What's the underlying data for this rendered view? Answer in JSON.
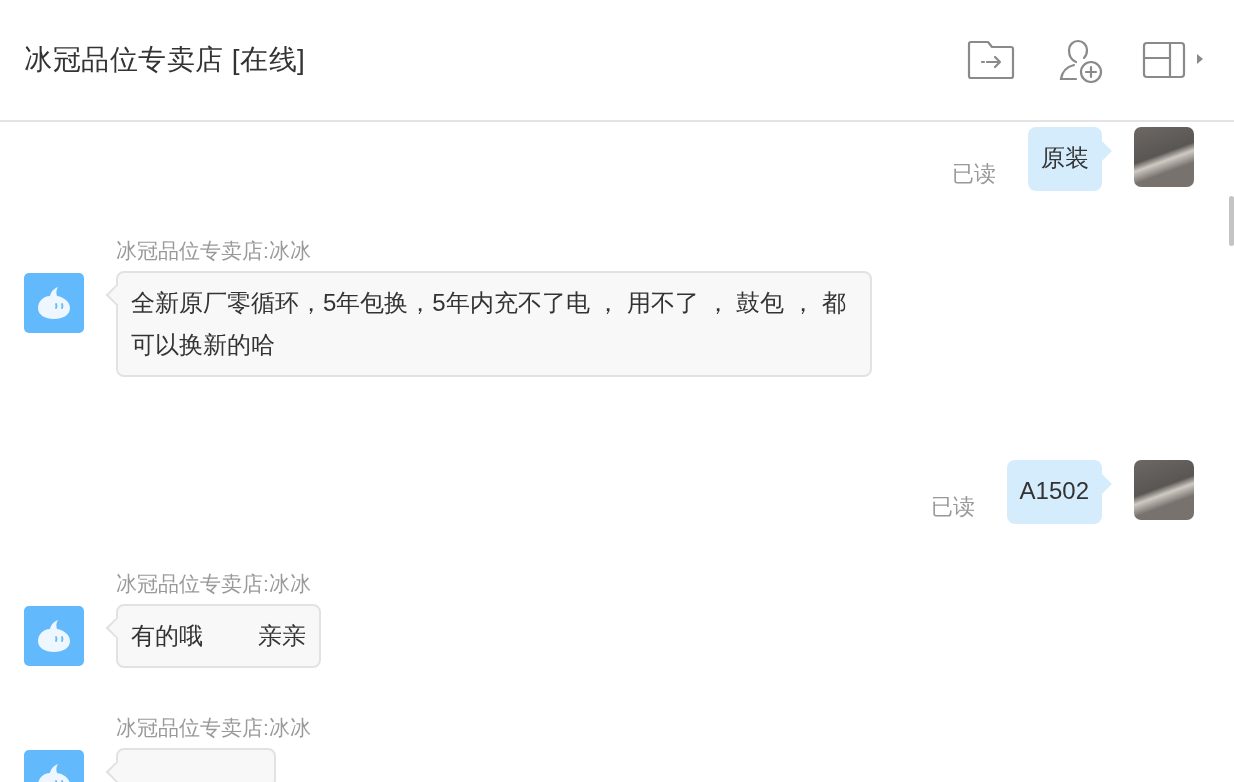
{
  "header": {
    "title": "冰冠品位专卖店 [在线]"
  },
  "messages": [
    {
      "kind": "sent",
      "text": "原装",
      "status": "已读"
    },
    {
      "kind": "received",
      "sender": "冰冠品位专卖店:冰冰",
      "text": "全新原厂零循环，5年包换，5年内充不了电 ， 用不了 ， 鼓包 ， 都可以换新的哈"
    },
    {
      "kind": "sent",
      "text": "A1502",
      "status": "已读"
    },
    {
      "kind": "received",
      "sender": "冰冠品位专卖店:冰冰",
      "text": "有的哦　　 亲亲"
    },
    {
      "kind": "received",
      "sender": "冰冠品位专卖店:冰冰"
    }
  ]
}
